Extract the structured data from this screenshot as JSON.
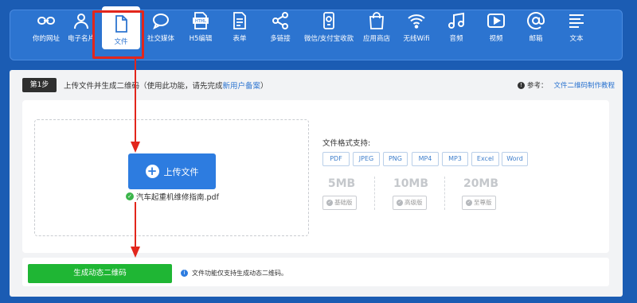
{
  "nav": {
    "items": [
      {
        "label": "你的网址",
        "icon": "link-icon"
      },
      {
        "label": "电子名片",
        "icon": "person-icon"
      },
      {
        "label": "文件",
        "icon": "file-icon",
        "active": true
      },
      {
        "label": "社交媒体",
        "icon": "chat-bubble-icon"
      },
      {
        "label": "H5编辑",
        "icon": "html-file-icon"
      },
      {
        "label": "表单",
        "icon": "form-icon"
      },
      {
        "label": "多链接",
        "icon": "share-icon"
      },
      {
        "label": "微信/支付宝收款",
        "icon": "payment-icon"
      },
      {
        "label": "应用商店",
        "icon": "shopping-bag-icon"
      },
      {
        "label": "无线Wifi",
        "icon": "wifi-icon"
      },
      {
        "label": "音频",
        "icon": "music-note-icon"
      },
      {
        "label": "视频",
        "icon": "play-icon"
      },
      {
        "label": "邮箱",
        "icon": "at-sign-icon"
      },
      {
        "label": "文本",
        "icon": "text-lines-icon"
      }
    ]
  },
  "step": {
    "badge": "第1步",
    "text_prefix": "上传文件并生成二维码（使用此功能，请先完成",
    "text_link": "新用户备案",
    "text_suffix": "）"
  },
  "reference": {
    "label": "参考：",
    "link": "文件二维码制作教程"
  },
  "upload": {
    "button_label": "上传文件",
    "file_name": "汽车起重机维修指南.pdf"
  },
  "formats": {
    "title": "文件格式支持:",
    "list": [
      "PDF",
      "JPEG",
      "PNG",
      "MP4",
      "MP3",
      "Excel",
      "Word"
    ]
  },
  "tiers": [
    {
      "size": "5MB",
      "name": "基础版"
    },
    {
      "size": "10MB",
      "name": "高级版"
    },
    {
      "size": "20MB",
      "name": "至尊版"
    }
  ],
  "generate": {
    "button_label": "生成动态二维码",
    "note": "文件功能仅支持生成动态二维码。"
  },
  "colors": {
    "nav_bg": "#2c74d0",
    "highlight": "#e2261c",
    "primary": "#2d7ce0",
    "success": "#1fb634"
  }
}
